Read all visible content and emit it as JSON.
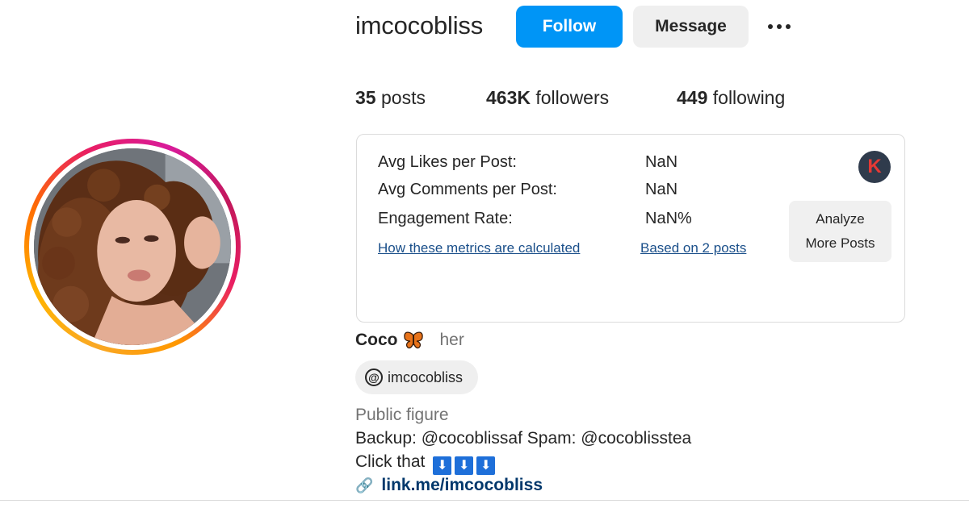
{
  "profile": {
    "username": "imcocobliss",
    "avatar_alt": "profile picture",
    "follow_label": "Follow",
    "message_label": "Message",
    "more_icon": "more-options-icon"
  },
  "stats": {
    "posts_count": "35",
    "posts_label": "posts",
    "followers_count": "463K",
    "followers_label": "followers",
    "following_count": "449",
    "following_label": "following"
  },
  "metrics": {
    "avg_likes_label": "Avg Likes per Post:",
    "avg_likes_value": "NaN",
    "avg_comments_label": "Avg Comments per Post:",
    "avg_comments_value": "NaN",
    "engagement_label": "Engagement Rate:",
    "engagement_value": "NaN%",
    "how_link": "How these metrics are calculated",
    "based_link": "Based on 2 posts",
    "badge_letter": "K",
    "analyze_line1": "Analyze",
    "analyze_line2": "More Posts"
  },
  "bio": {
    "name": "Coco",
    "pronouns": "her",
    "threads_handle": "imcocobliss",
    "threads_icon": "@",
    "category": "Public figure",
    "line1_prefix": "Backup: ",
    "backup_mention": "@cocoblissaf",
    "line1_mid": " Spam: ",
    "spam_mention": "@cocoblisstea",
    "line2_text": "Click that",
    "arrow_glyph": "⬇",
    "link_icon": "🔗",
    "link_url": "link.me/imcocobliss"
  },
  "colors": {
    "follow_blue": "#0095f6",
    "link_blue": "#00376b",
    "badge_bg": "#2f3b4c",
    "badge_letter": "#e53935"
  }
}
